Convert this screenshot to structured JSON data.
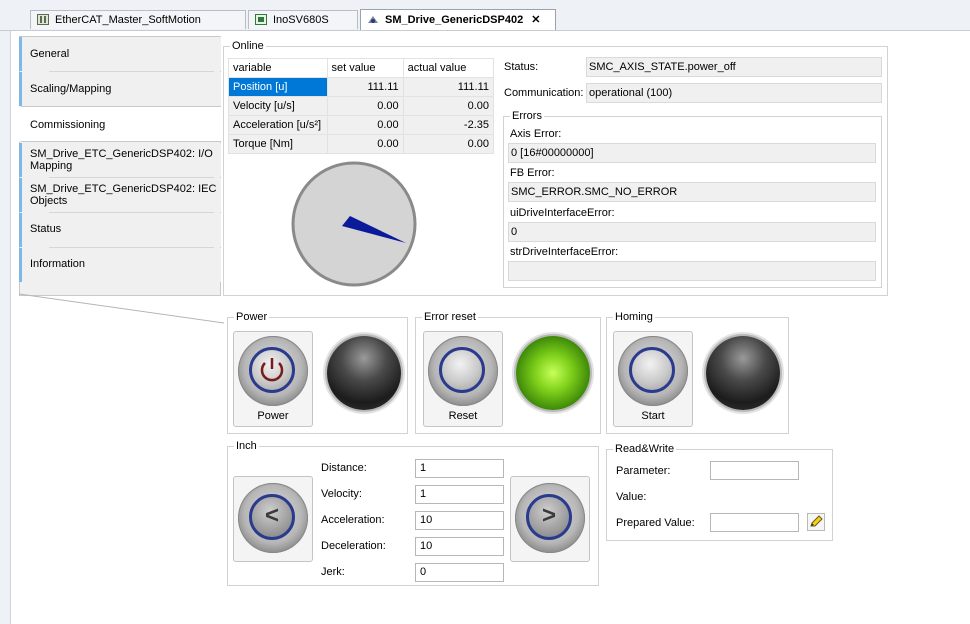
{
  "tabs": [
    {
      "label": "EtherCAT_Master_SoftMotion",
      "icon": "device-icon"
    },
    {
      "label": "InoSV680S",
      "icon": "drive-icon"
    },
    {
      "label": "SM_Drive_GenericDSP402",
      "icon": "axis-icon",
      "active": true
    }
  ],
  "sidebar": {
    "items": [
      {
        "label": "General"
      },
      {
        "label": "Scaling/Mapping"
      },
      {
        "label": "Commissioning",
        "active": true
      },
      {
        "label": "SM_Drive_ETC_GenericDSP402: I/O Mapping"
      },
      {
        "label": "SM_Drive_ETC_GenericDSP402: IEC Objects"
      },
      {
        "label": "Status"
      },
      {
        "label": "Information"
      }
    ]
  },
  "online": {
    "title": "Online",
    "columns": [
      "variable",
      "set value",
      "actual value"
    ],
    "rows": [
      {
        "variable": "Position [u]",
        "set": "111.11",
        "actual": "111.11"
      },
      {
        "variable": "Velocity [u/s]",
        "set": "0.00",
        "actual": "0.00"
      },
      {
        "variable": "Acceleration [u/s²]",
        "set": "0.00",
        "actual": "-2.35"
      },
      {
        "variable": "Torque [Nm]",
        "set": "0.00",
        "actual": "0.00"
      }
    ],
    "status_label": "Status:",
    "status_value": "SMC_AXIS_STATE.power_off",
    "communication_label": "Communication:",
    "communication_value": "operational (100)"
  },
  "errors": {
    "title": "Errors",
    "axis_error_label": "Axis Error:",
    "axis_error_value": "0 [16#00000000]",
    "fb_error_label": "FB Error:",
    "fb_error_value": "SMC_ERROR.SMC_NO_ERROR",
    "ui_drive_label": "uiDriveInterfaceError:",
    "ui_drive_value": "0",
    "str_drive_label": "strDriveInterfaceError:",
    "str_drive_value": ""
  },
  "power": {
    "title": "Power",
    "button_label": "Power",
    "lamp": "off"
  },
  "error_reset": {
    "title": "Error reset",
    "button_label": "Reset",
    "lamp": "on"
  },
  "homing": {
    "title": "Homing",
    "button_label": "Start",
    "lamp": "off"
  },
  "inch": {
    "title": "Inch",
    "distance_label": "Distance:",
    "distance_value": "1",
    "velocity_label": "Velocity:",
    "velocity_value": "1",
    "acceleration_label": "Acceleration:",
    "acceleration_value": "10",
    "deceleration_label": "Deceleration:",
    "deceleration_value": "10",
    "jerk_label": "Jerk:",
    "jerk_value": "0",
    "left_glyph": "<",
    "right_glyph": ">"
  },
  "readwrite": {
    "title": "Read&Write",
    "parameter_label": "Parameter:",
    "parameter_value": "",
    "value_label": "Value:",
    "prepared_label": "Prepared Value:",
    "prepared_value": "",
    "write_icon": "pencil-icon"
  },
  "colors": {
    "selection": "#0078d7",
    "accent": "#7fb8e6",
    "needle": "#0a1a9a",
    "lamp_on": "#7ed01a"
  }
}
